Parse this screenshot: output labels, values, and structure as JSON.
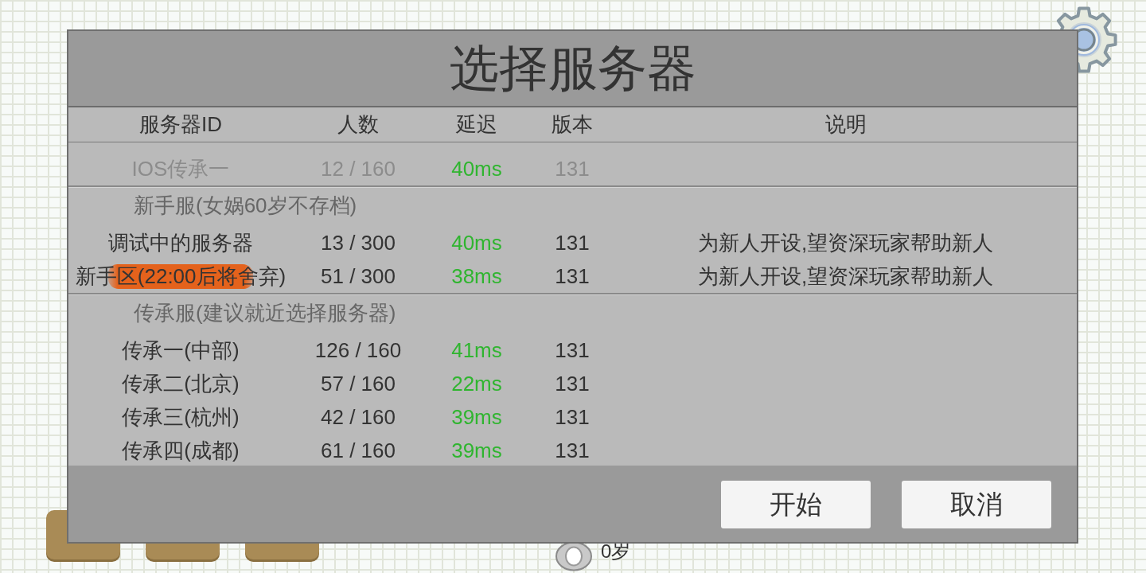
{
  "background": {
    "age_label": "0岁"
  },
  "dialog": {
    "title": "选择服务器",
    "columns": [
      "服务器ID",
      "人数",
      "延迟",
      "版本",
      "说明"
    ],
    "groups": [
      {
        "rows": [
          {
            "name": "IOS传承一",
            "players": "12 / 160",
            "latency": "40ms",
            "version": "131",
            "disabled": true,
            "marked": false
          }
        ]
      },
      {
        "header": "新手服(女娲60岁不存档)",
        "rows": [
          {
            "name": "调试中的服务器",
            "players": "13 / 300",
            "latency": "40ms",
            "version": "131",
            "note": "为新人开设,望资深玩家帮助新人",
            "disabled": false,
            "marked": false
          },
          {
            "name": "新手区(22:00后将舍弃)",
            "players": "51 / 300",
            "latency": "38ms",
            "version": "131",
            "note": "为新人开设,望资深玩家帮助新人",
            "disabled": false,
            "marked": true
          }
        ]
      },
      {
        "header": "传承服(建议就近选择服务器)",
        "rows": [
          {
            "name": "传承一(中部)",
            "players": "126 / 160",
            "latency": "41ms",
            "version": "131",
            "disabled": false,
            "marked": false
          },
          {
            "name": "传承二(北京)",
            "players": "57 / 160",
            "latency": "22ms",
            "version": "131",
            "disabled": false,
            "marked": false
          },
          {
            "name": "传承三(杭州)",
            "players": "42 / 160",
            "latency": "39ms",
            "version": "131",
            "disabled": false,
            "marked": false
          },
          {
            "name": "传承四(成都)",
            "players": "61 / 160",
            "latency": "39ms",
            "version": "131",
            "disabled": false,
            "marked": false
          }
        ]
      }
    ],
    "buttons": [
      "开始",
      "取消"
    ]
  }
}
